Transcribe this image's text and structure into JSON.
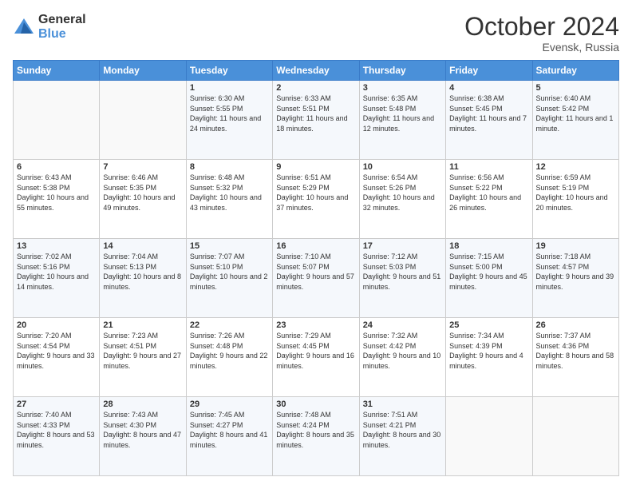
{
  "header": {
    "logo_general": "General",
    "logo_blue": "Blue",
    "month_title": "October 2024",
    "location": "Evensk, Russia"
  },
  "weekdays": [
    "Sunday",
    "Monday",
    "Tuesday",
    "Wednesday",
    "Thursday",
    "Friday",
    "Saturday"
  ],
  "weeks": [
    [
      {
        "day": "",
        "sunrise": "",
        "sunset": "",
        "daylight": ""
      },
      {
        "day": "",
        "sunrise": "",
        "sunset": "",
        "daylight": ""
      },
      {
        "day": "1",
        "sunrise": "Sunrise: 6:30 AM",
        "sunset": "Sunset: 5:55 PM",
        "daylight": "Daylight: 11 hours and 24 minutes."
      },
      {
        "day": "2",
        "sunrise": "Sunrise: 6:33 AM",
        "sunset": "Sunset: 5:51 PM",
        "daylight": "Daylight: 11 hours and 18 minutes."
      },
      {
        "day": "3",
        "sunrise": "Sunrise: 6:35 AM",
        "sunset": "Sunset: 5:48 PM",
        "daylight": "Daylight: 11 hours and 12 minutes."
      },
      {
        "day": "4",
        "sunrise": "Sunrise: 6:38 AM",
        "sunset": "Sunset: 5:45 PM",
        "daylight": "Daylight: 11 hours and 7 minutes."
      },
      {
        "day": "5",
        "sunrise": "Sunrise: 6:40 AM",
        "sunset": "Sunset: 5:42 PM",
        "daylight": "Daylight: 11 hours and 1 minute."
      }
    ],
    [
      {
        "day": "6",
        "sunrise": "Sunrise: 6:43 AM",
        "sunset": "Sunset: 5:38 PM",
        "daylight": "Daylight: 10 hours and 55 minutes."
      },
      {
        "day": "7",
        "sunrise": "Sunrise: 6:46 AM",
        "sunset": "Sunset: 5:35 PM",
        "daylight": "Daylight: 10 hours and 49 minutes."
      },
      {
        "day": "8",
        "sunrise": "Sunrise: 6:48 AM",
        "sunset": "Sunset: 5:32 PM",
        "daylight": "Daylight: 10 hours and 43 minutes."
      },
      {
        "day": "9",
        "sunrise": "Sunrise: 6:51 AM",
        "sunset": "Sunset: 5:29 PM",
        "daylight": "Daylight: 10 hours and 37 minutes."
      },
      {
        "day": "10",
        "sunrise": "Sunrise: 6:54 AM",
        "sunset": "Sunset: 5:26 PM",
        "daylight": "Daylight: 10 hours and 32 minutes."
      },
      {
        "day": "11",
        "sunrise": "Sunrise: 6:56 AM",
        "sunset": "Sunset: 5:22 PM",
        "daylight": "Daylight: 10 hours and 26 minutes."
      },
      {
        "day": "12",
        "sunrise": "Sunrise: 6:59 AM",
        "sunset": "Sunset: 5:19 PM",
        "daylight": "Daylight: 10 hours and 20 minutes."
      }
    ],
    [
      {
        "day": "13",
        "sunrise": "Sunrise: 7:02 AM",
        "sunset": "Sunset: 5:16 PM",
        "daylight": "Daylight: 10 hours and 14 minutes."
      },
      {
        "day": "14",
        "sunrise": "Sunrise: 7:04 AM",
        "sunset": "Sunset: 5:13 PM",
        "daylight": "Daylight: 10 hours and 8 minutes."
      },
      {
        "day": "15",
        "sunrise": "Sunrise: 7:07 AM",
        "sunset": "Sunset: 5:10 PM",
        "daylight": "Daylight: 10 hours and 2 minutes."
      },
      {
        "day": "16",
        "sunrise": "Sunrise: 7:10 AM",
        "sunset": "Sunset: 5:07 PM",
        "daylight": "Daylight: 9 hours and 57 minutes."
      },
      {
        "day": "17",
        "sunrise": "Sunrise: 7:12 AM",
        "sunset": "Sunset: 5:03 PM",
        "daylight": "Daylight: 9 hours and 51 minutes."
      },
      {
        "day": "18",
        "sunrise": "Sunrise: 7:15 AM",
        "sunset": "Sunset: 5:00 PM",
        "daylight": "Daylight: 9 hours and 45 minutes."
      },
      {
        "day": "19",
        "sunrise": "Sunrise: 7:18 AM",
        "sunset": "Sunset: 4:57 PM",
        "daylight": "Daylight: 9 hours and 39 minutes."
      }
    ],
    [
      {
        "day": "20",
        "sunrise": "Sunrise: 7:20 AM",
        "sunset": "Sunset: 4:54 PM",
        "daylight": "Daylight: 9 hours and 33 minutes."
      },
      {
        "day": "21",
        "sunrise": "Sunrise: 7:23 AM",
        "sunset": "Sunset: 4:51 PM",
        "daylight": "Daylight: 9 hours and 27 minutes."
      },
      {
        "day": "22",
        "sunrise": "Sunrise: 7:26 AM",
        "sunset": "Sunset: 4:48 PM",
        "daylight": "Daylight: 9 hours and 22 minutes."
      },
      {
        "day": "23",
        "sunrise": "Sunrise: 7:29 AM",
        "sunset": "Sunset: 4:45 PM",
        "daylight": "Daylight: 9 hours and 16 minutes."
      },
      {
        "day": "24",
        "sunrise": "Sunrise: 7:32 AM",
        "sunset": "Sunset: 4:42 PM",
        "daylight": "Daylight: 9 hours and 10 minutes."
      },
      {
        "day": "25",
        "sunrise": "Sunrise: 7:34 AM",
        "sunset": "Sunset: 4:39 PM",
        "daylight": "Daylight: 9 hours and 4 minutes."
      },
      {
        "day": "26",
        "sunrise": "Sunrise: 7:37 AM",
        "sunset": "Sunset: 4:36 PM",
        "daylight": "Daylight: 8 hours and 58 minutes."
      }
    ],
    [
      {
        "day": "27",
        "sunrise": "Sunrise: 7:40 AM",
        "sunset": "Sunset: 4:33 PM",
        "daylight": "Daylight: 8 hours and 53 minutes."
      },
      {
        "day": "28",
        "sunrise": "Sunrise: 7:43 AM",
        "sunset": "Sunset: 4:30 PM",
        "daylight": "Daylight: 8 hours and 47 minutes."
      },
      {
        "day": "29",
        "sunrise": "Sunrise: 7:45 AM",
        "sunset": "Sunset: 4:27 PM",
        "daylight": "Daylight: 8 hours and 41 minutes."
      },
      {
        "day": "30",
        "sunrise": "Sunrise: 7:48 AM",
        "sunset": "Sunset: 4:24 PM",
        "daylight": "Daylight: 8 hours and 35 minutes."
      },
      {
        "day": "31",
        "sunrise": "Sunrise: 7:51 AM",
        "sunset": "Sunset: 4:21 PM",
        "daylight": "Daylight: 8 hours and 30 minutes."
      },
      {
        "day": "",
        "sunrise": "",
        "sunset": "",
        "daylight": ""
      },
      {
        "day": "",
        "sunrise": "",
        "sunset": "",
        "daylight": ""
      }
    ]
  ]
}
